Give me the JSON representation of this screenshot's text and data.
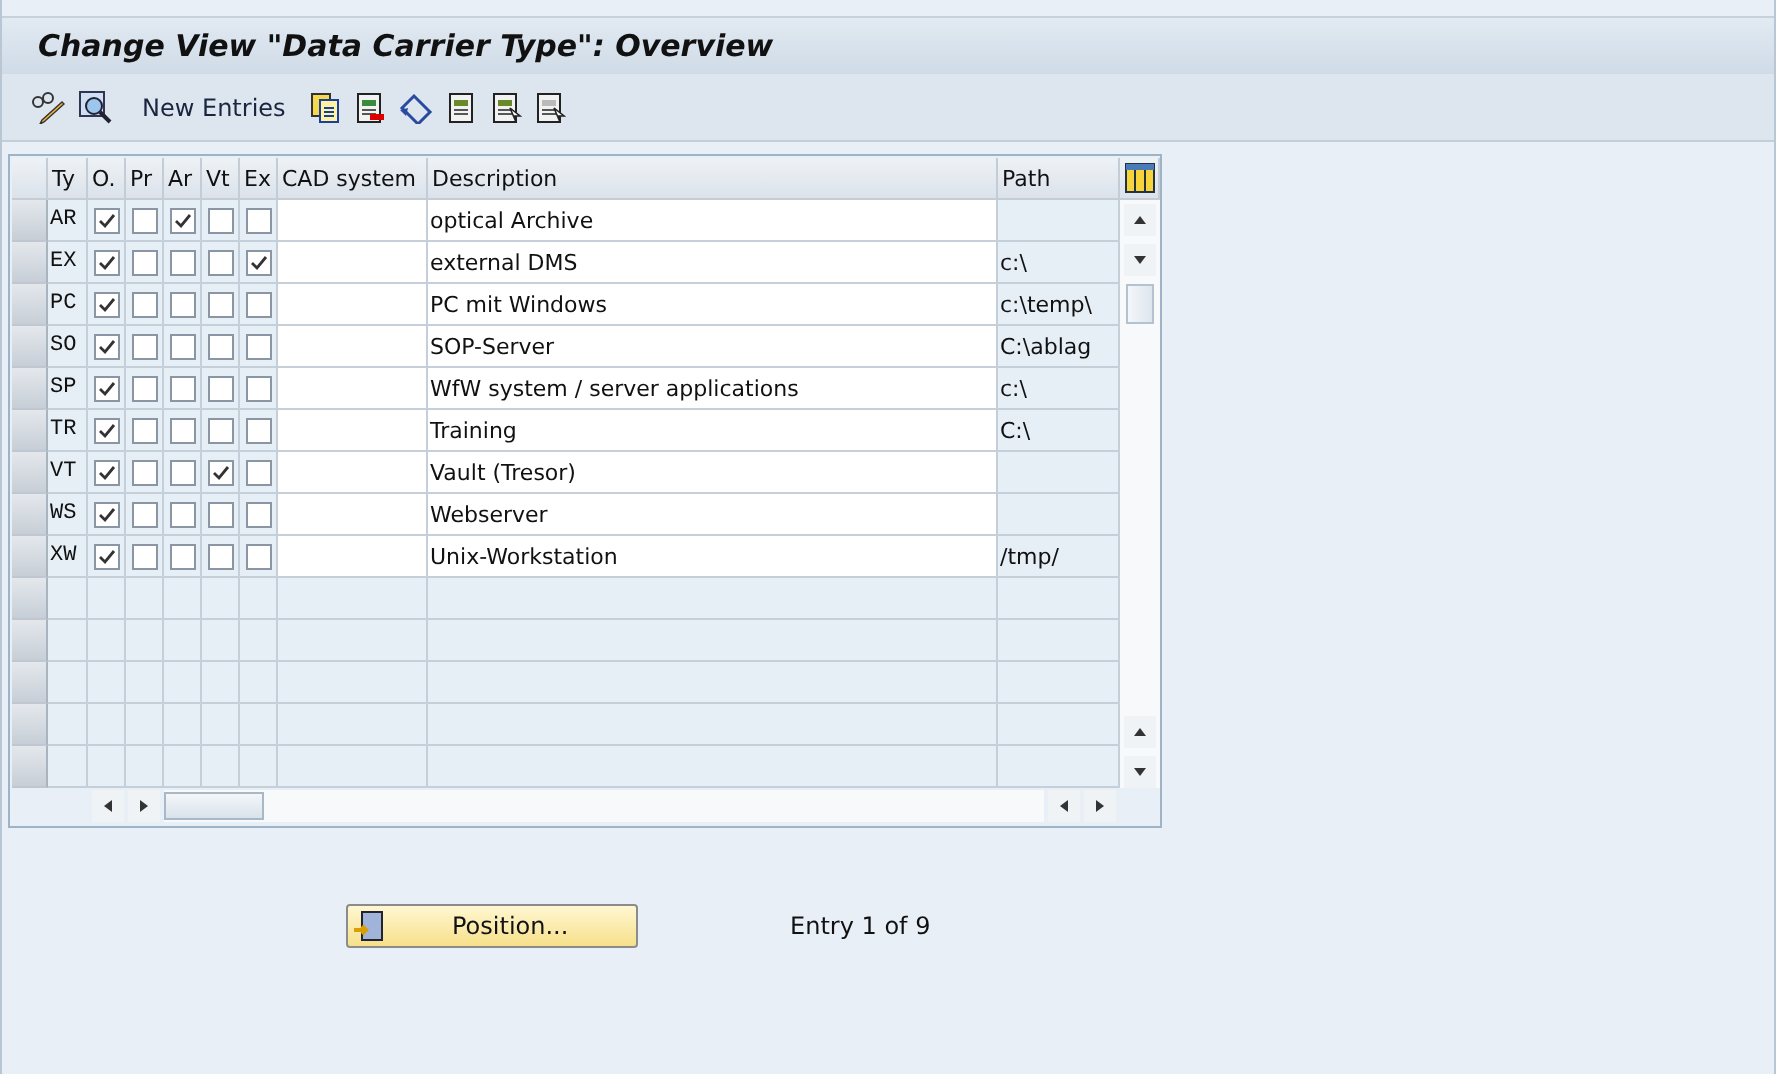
{
  "window": {
    "title": "Change View \"Data Carrier Type\": Overview"
  },
  "toolbar": {
    "new_entries": "New Entries"
  },
  "table": {
    "columns": [
      "Ty",
      "O.",
      "Pr",
      "Ar",
      "Vt",
      "Ex",
      "CAD system",
      "Description",
      "Path"
    ],
    "rows": [
      {
        "type": "AR",
        "checks": [
          true,
          false,
          true,
          false,
          false
        ],
        "description": "optical Archive"
      },
      {
        "type": "EX",
        "checks": [
          true,
          false,
          false,
          false,
          true
        ],
        "description": "external DMS",
        "path": "c:\\"
      },
      {
        "type": "PC",
        "checks": [
          true,
          false,
          false,
          false,
          false
        ],
        "description": "PC mit Windows",
        "path": "c:\\temp\\"
      },
      {
        "type": "SO",
        "checks": [
          true,
          false,
          false,
          false,
          false
        ],
        "description": "SOP-Server",
        "path": "C:\\ablag"
      },
      {
        "type": "SP",
        "checks": [
          true,
          false,
          false,
          false,
          false
        ],
        "description": "WfW system / server applications",
        "path": "c:\\"
      },
      {
        "type": "TR",
        "checks": [
          true,
          false,
          false,
          false,
          false
        ],
        "description": "Training",
        "path": "C:\\"
      },
      {
        "type": "VT",
        "checks": [
          true,
          false,
          false,
          true,
          false
        ],
        "description": "Vault (Tresor)"
      },
      {
        "type": "WS",
        "checks": [
          true,
          false,
          false,
          false,
          false
        ],
        "description": "Webserver"
      },
      {
        "type": "XW",
        "checks": [
          true,
          false,
          false,
          false,
          false
        ],
        "description": "Unix-Workstation",
        "path": "/tmp/"
      }
    ]
  },
  "footer": {
    "position_button": "Position...",
    "entry_info": "Entry 1 of 9"
  }
}
